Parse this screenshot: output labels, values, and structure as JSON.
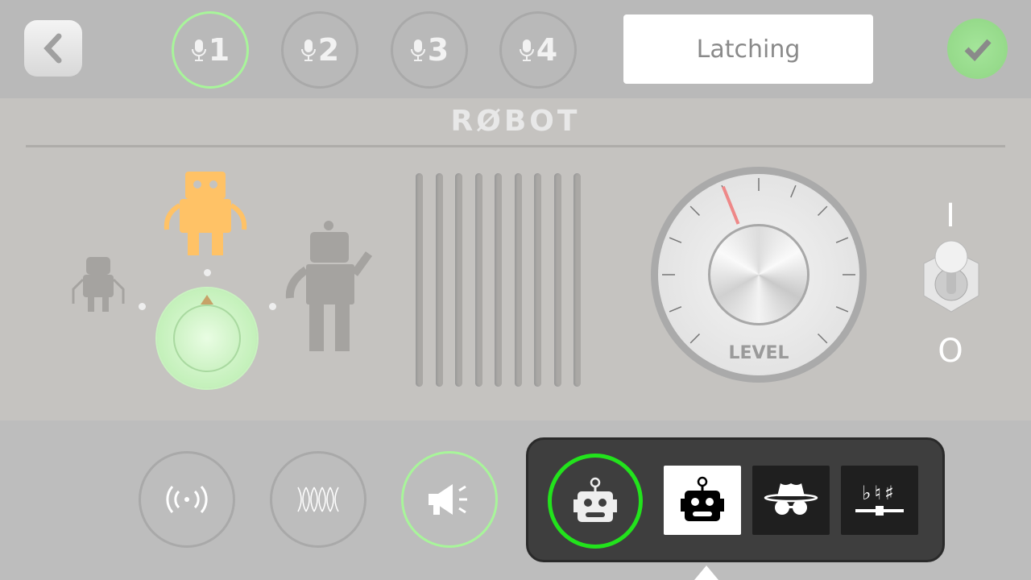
{
  "header": {
    "back_icon": "chevron-left-icon",
    "mics": [
      {
        "label": "1",
        "selected": true
      },
      {
        "label": "2"
      },
      {
        "label": "3"
      },
      {
        "label": "4"
      }
    ],
    "mode": "Latching",
    "confirm_icon": "checkmark-icon"
  },
  "panel": {
    "title": "RØBOT",
    "dial_label": "LEVEL",
    "toggle_on": "I",
    "toggle_off": "O",
    "accent": "#a8f59a",
    "active_robot_color": "#ffc266"
  },
  "bottom": {
    "effects": [
      "radio-waves-icon",
      "wave-mesh-icon",
      "megaphone-icon"
    ],
    "presets": [
      {
        "icon": "robot-icon",
        "selected": true
      },
      {
        "icon": "spy-icon"
      },
      {
        "icon": "pitch-accidentals-icon",
        "label": "♭♮♯"
      }
    ],
    "ring_color": "#22e31c"
  }
}
